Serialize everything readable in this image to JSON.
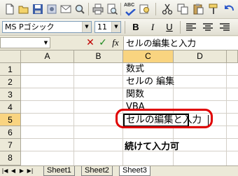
{
  "toolbar": {
    "icons": [
      "new-file-icon",
      "open-folder-icon",
      "save-icon",
      "permission-icon",
      "email-icon",
      "search-icon",
      "print-icon",
      "print-preview-icon",
      "spellcheck-icon",
      "research-icon",
      "cut-icon",
      "copy-icon",
      "paste-icon",
      "format-painter-icon",
      "undo-icon"
    ],
    "spellcheck_label": "ABC"
  },
  "format": {
    "font_name": "MS Pゴシック",
    "font_size": "11",
    "bold": "B",
    "italic": "I",
    "underline": "U"
  },
  "formula_bar": {
    "cancel": "✕",
    "enter": "✓",
    "fx": "fx",
    "content": "セルの編集と入力"
  },
  "grid": {
    "columns": [
      "A",
      "B",
      "C",
      "D"
    ],
    "selected_column": "C",
    "rows": [
      "1",
      "2",
      "3",
      "4",
      "5",
      "6",
      "7",
      "8"
    ],
    "selected_row": "5",
    "cells": {
      "C1": "数式",
      "C2": "セルの 編集",
      "C3": "関数",
      "C4": "VBA",
      "C5": "セルの編集と入力",
      "C7": "続けて入力可"
    }
  },
  "sheets": {
    "tabs": [
      "Sheet1",
      "Sheet2",
      "Sheet3"
    ],
    "active": "Sheet3"
  },
  "colors": {
    "highlight_ring": "#e00000",
    "header_selected": "#f9d480"
  }
}
